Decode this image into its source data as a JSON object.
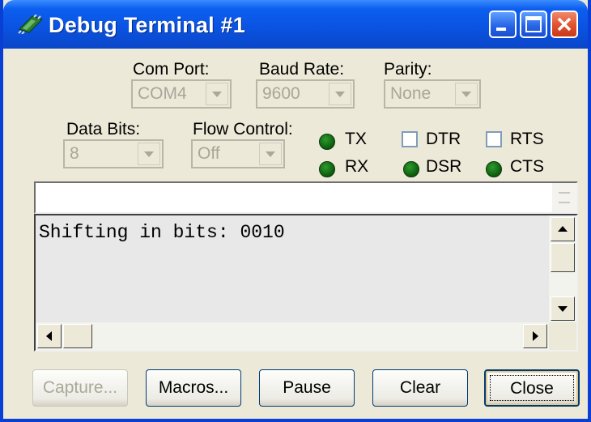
{
  "window": {
    "title": "Debug Terminal #1"
  },
  "settings": {
    "com_port": {
      "label": "Com Port:",
      "value": "COM4"
    },
    "baud_rate": {
      "label": "Baud Rate:",
      "value": "9600"
    },
    "parity": {
      "label": "Parity:",
      "value": "None"
    },
    "data_bits": {
      "label": "Data Bits:",
      "value": "8"
    },
    "flow_control": {
      "label": "Flow Control:",
      "value": "Off"
    }
  },
  "indicators": {
    "tx": "TX",
    "rx": "RX",
    "dsr": "DSR",
    "cts": "CTS",
    "led_color": "#1a7a1a"
  },
  "checkboxes": {
    "dtr": "DTR",
    "rts": "RTS"
  },
  "transmit": {
    "value": ""
  },
  "receive": {
    "text": "Shifting in bits: 0010"
  },
  "buttons": {
    "capture": "Capture...",
    "macros": "Macros...",
    "pause": "Pause",
    "clear": "Clear",
    "close": "Close"
  },
  "colors": {
    "titlebar": "#0a52e0",
    "window_bg": "#ece9d8",
    "close_button": "#e0502c"
  }
}
